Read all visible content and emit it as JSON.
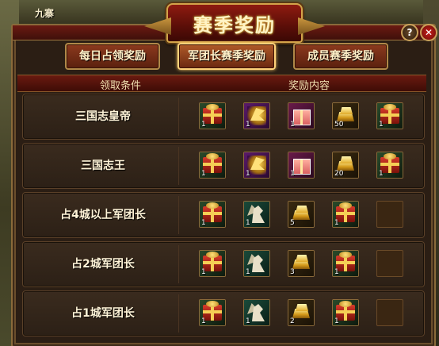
{
  "map_label": "九寨",
  "window": {
    "title": "赛季奖励",
    "help_label": "?",
    "close_label": "✕"
  },
  "tabs": [
    {
      "label": "每日占领奖励",
      "active": false
    },
    {
      "label": "军团长赛季奖励",
      "active": true
    },
    {
      "label": "成员赛季奖励",
      "active": false
    }
  ],
  "table": {
    "col_condition": "领取条件",
    "col_rewards": "奖励内容"
  },
  "rows": [
    {
      "name": "三国志皇帝",
      "rewards": [
        {
          "icon": "gift-icon",
          "qty": "1"
        },
        {
          "icon": "mount-icon",
          "qty": "1"
        },
        {
          "icon": "gift-box-icon",
          "qty": "1"
        },
        {
          "icon": "gold-ingot-icon",
          "qty": "50"
        },
        {
          "icon": "gift-icon",
          "qty": "1"
        }
      ]
    },
    {
      "name": "三国志王",
      "rewards": [
        {
          "icon": "gift-icon",
          "qty": "1"
        },
        {
          "icon": "mount-icon",
          "qty": "1"
        },
        {
          "icon": "gift-box-icon",
          "qty": "1"
        },
        {
          "icon": "gold-ingot-icon",
          "qty": "20"
        },
        {
          "icon": "gift-icon",
          "qty": "1"
        }
      ]
    },
    {
      "name": "占4城以上军团长",
      "rewards": [
        {
          "icon": "gift-icon",
          "qty": "1"
        },
        {
          "icon": "white-mount-icon",
          "qty": "1"
        },
        {
          "icon": "gold-ingot-icon",
          "qty": "5"
        },
        {
          "icon": "gift-icon",
          "qty": "1"
        },
        {
          "icon": "empty-slot",
          "qty": ""
        }
      ]
    },
    {
      "name": "占2城军团长",
      "rewards": [
        {
          "icon": "gift-icon",
          "qty": "1"
        },
        {
          "icon": "white-mount-icon",
          "qty": "1"
        },
        {
          "icon": "gold-ingot-icon",
          "qty": "3"
        },
        {
          "icon": "gift-icon",
          "qty": "1"
        },
        {
          "icon": "empty-slot",
          "qty": ""
        }
      ]
    },
    {
      "name": "占1城军团长",
      "rewards": [
        {
          "icon": "gift-icon",
          "qty": "1"
        },
        {
          "icon": "white-mount-icon",
          "qty": "1"
        },
        {
          "icon": "gold-ingot-icon",
          "qty": "2"
        },
        {
          "icon": "gift-icon",
          "qty": "1"
        },
        {
          "icon": "empty-slot",
          "qty": ""
        }
      ]
    }
  ]
}
